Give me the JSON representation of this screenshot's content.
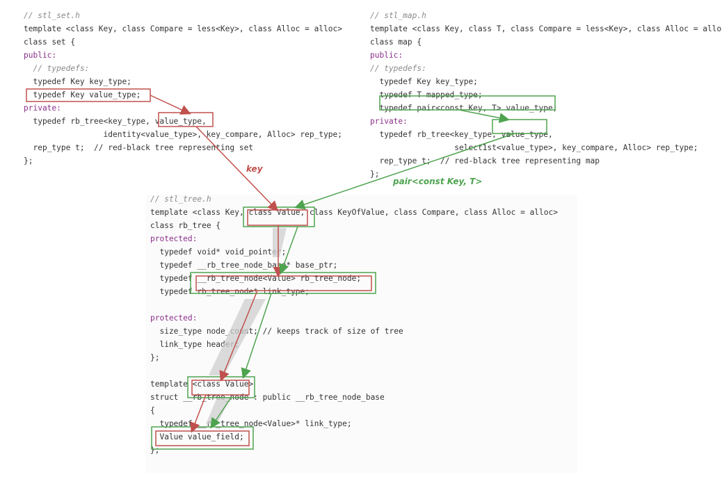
{
  "colors": {
    "red": "#c0504d",
    "green": "#4ea34f",
    "comment": "#8a8a8a",
    "keyword": "#8a2f8a",
    "type": "#3a5ec0"
  },
  "set_h": {
    "lines": [
      "// stl_set.h",
      "template <class Key, class Compare = less<Key>, class Alloc = alloc>",
      "class set {",
      "public:",
      "  // typedefs:",
      "  typedef Key key_type;",
      "  typedef Key value_type;",
      "private:",
      "  typedef rb_tree<key_type, value_type,",
      "                 identity<value_type>, key_compare, Alloc> rep_type;",
      "  rep_type t;  // red-black tree representing set",
      "};"
    ]
  },
  "map_h": {
    "lines": [
      "// stl_map.h",
      "template <class Key, class T, class Compare = less<Key>, class Alloc = alloc>",
      "class map {",
      "public:",
      "// typedefs:",
      "  typedef Key key_type;",
      "  typedef T mapped_type;",
      "  typedef pair<const Key, T> value_type;",
      "private:",
      "  typedef rb_tree<key_type, value_type,",
      "                  select1st<value_type>, key_compare, Alloc> rep_type;",
      "  rep_type t;  // red-black tree representing map",
      "};"
    ]
  },
  "tree_h": {
    "lines": [
      "// stl_tree.h",
      "template <class Key, class Value, class KeyOfValue, class Compare, class Alloc = alloc>",
      "class rb_tree {",
      "protected:",
      "  typedef void* void_pointer;",
      "  typedef __rb_tree_node_base* base_ptr;",
      "  typedef __rb_tree_node<Value> rb_tree_node;",
      "  typedef rb_tree_node* link_type;",
      "",
      "protected:",
      "  size_type node_count; // keeps track of size of tree",
      "  link_type header;",
      "};",
      "",
      "template <class Value>",
      "struct __rb_tree_node : public __rb_tree_node_base",
      "{",
      "  typedef __rb_tree_node<Value>* link_type;",
      "  Value value_field;",
      "};"
    ]
  },
  "annotations": {
    "key_label": "key",
    "pair_label": "pair<const Key, T>"
  }
}
